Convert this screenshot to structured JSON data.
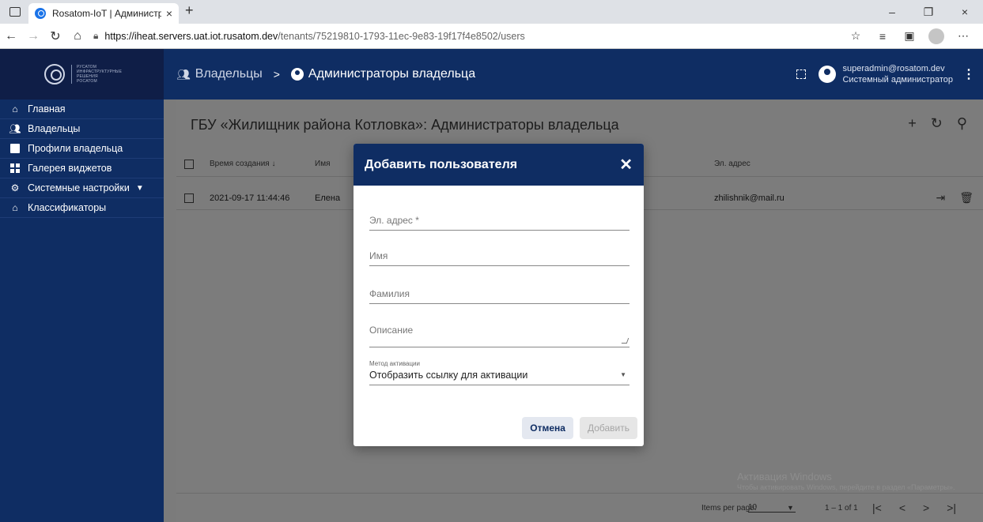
{
  "browser": {
    "tab_title": "Rosatom-IoT | Администраторы",
    "tab_close": "×",
    "new_tab": "+",
    "window_controls": [
      "–",
      "❐",
      "×"
    ],
    "url_host": "https://iheat.servers.uat.iot.rusatom.dev",
    "url_path": "/tenants/75219810-1793-11ec-9e83-19f17f4e8502/users"
  },
  "logo": {
    "line1": "РУСАТОМ",
    "line2": "ИНФРАСТРУКТУРНЫЕ",
    "line3": "РЕШЕНИЯ",
    "line4": "РОСАТОМ"
  },
  "header": {
    "breadcrumb_owners": "Владельцы",
    "breadcrumb_sep": ">",
    "breadcrumb_admins": "Администраторы владельца",
    "user_email": "superadmin@rosatom.dev",
    "user_role": "Системный администратор"
  },
  "sidebar": {
    "items": [
      {
        "label": "Главная",
        "icon": "home-icon"
      },
      {
        "label": "Владельцы",
        "icon": "people-icon"
      },
      {
        "label": "Профили владельца",
        "icon": "profile-icon"
      },
      {
        "label": "Галерея виджетов",
        "icon": "widgets-icon"
      },
      {
        "label": "Системные настройки",
        "icon": "gear-icon"
      },
      {
        "label": "Классификаторы",
        "icon": "home-icon"
      }
    ]
  },
  "card": {
    "title": "ГБУ «Жилищник района Котловка»: Администраторы владельца",
    "columns": {
      "time": "Время создания",
      "name": "Имя",
      "email": "Эл. адрес"
    },
    "rows": [
      {
        "time": "2021-09-17 11:44:46",
        "name": "Елена",
        "email": "zhilishnik@mail.ru"
      }
    ]
  },
  "pager": {
    "items_per_page_label": "Items per page:",
    "items_per_page_value": "10",
    "range": "1 – 1 of 1"
  },
  "watermark": {
    "line1": "Активация Windows",
    "line2": "Чтобы активировать Windows, перейдите в раздел «Параметры»."
  },
  "dialog": {
    "title": "Добавить пользователя",
    "email_placeholder": "Эл. адрес *",
    "first_name_placeholder": "Имя",
    "last_name_placeholder": "Фамилия",
    "description_placeholder": "Описание",
    "activation_label": "Метод активации",
    "activation_value": "Отобразить ссылку для активации",
    "cancel_label": "Отмена",
    "add_label": "Добавить"
  }
}
